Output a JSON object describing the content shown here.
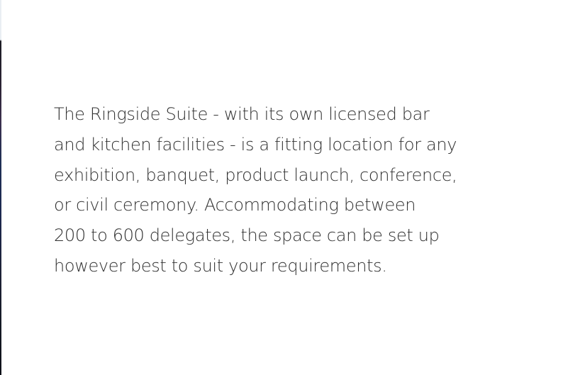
{
  "main": {
    "description_lines": [
      "The Ringside Suite - with its own licensed bar",
      "and kitchen facilities - is a fitting location for any",
      "exhibition, banquet, product launch, conference,",
      "or civil ceremony. Accommodating between",
      "200 to 600 delegates, the space can be set up",
      "however best to suit your requirements."
    ]
  },
  "colors": {
    "background": "#ffffff",
    "text": "#303030"
  }
}
